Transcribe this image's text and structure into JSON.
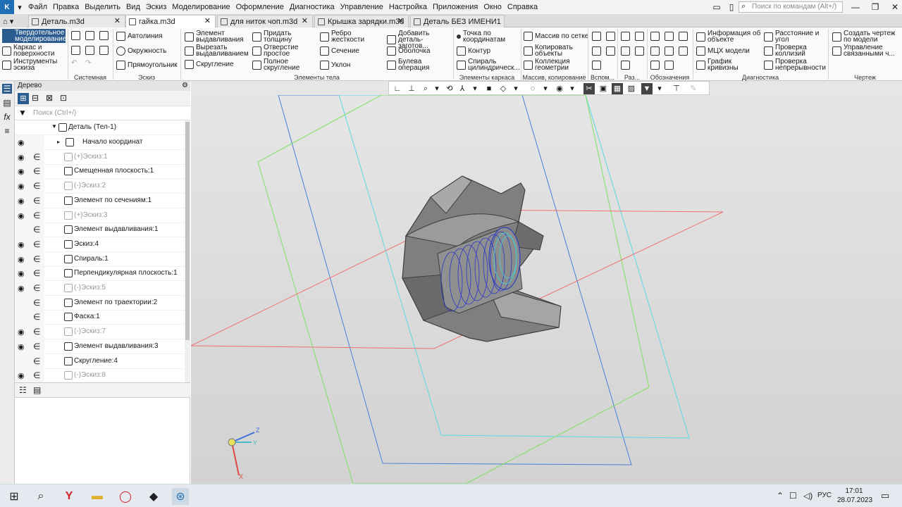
{
  "menu": [
    "Файл",
    "Правка",
    "Выделить",
    "Вид",
    "Эскиз",
    "Моделирование",
    "Оформление",
    "Диагностика",
    "Управление",
    "Настройка",
    "Приложения",
    "Окно",
    "Справка"
  ],
  "search": {
    "placeholder": "Поиск по командам (Alt+/)"
  },
  "tabs": [
    "Деталь.m3d",
    "гайка.m3d",
    "для ниток чоп.m3d",
    "Крышка зарядки.m3d",
    "Деталь БЕЗ ИМЕНИ1"
  ],
  "ribbon": {
    "mode_label": "Твердотельное моделирование",
    "mode_items": [
      "Каркас и поверхности",
      "Инструменты эскиза"
    ],
    "sketch": [
      "Автолиния",
      "Окружность",
      "Прямоугольник"
    ],
    "body": [
      "Элемент выдавливания",
      "Вырезать выдавливанием",
      "Скругление",
      "Придать толщину",
      "Отверстие простое",
      "Полное скругление",
      "Ребро жесткости",
      "Сечение",
      "Уклон",
      "Добавить деталь-заготов...",
      "Оболочка",
      "Булева операция"
    ],
    "frame": [
      "Точка по координатам",
      "Контур",
      "Спираль цилиндрическ..."
    ],
    "arrays": [
      "Массив по сетке",
      "Копировать объекты",
      "Коллекция геометрии"
    ],
    "diag": [
      "Информация об объекте",
      "МЦХ модели",
      "График кривизны",
      "Расстояние и угол",
      "Проверка коллизий",
      "Проверка непрерывности"
    ],
    "drawing": [
      "Создать чертеж по модели",
      "Управление связанными ч..."
    ],
    "groups": [
      "Системная",
      "Эскиз",
      "Элементы тела",
      "Элементы каркаса",
      "Массив, копирование",
      "Вспом...",
      "Раз...",
      "Обозначения",
      "Диагностика",
      "Чертеж"
    ]
  },
  "tree": {
    "title": "Дерево",
    "search_placeholder": "Поиск (Ctrl+/)",
    "root": "Деталь (Тел-1)",
    "items": [
      {
        "label": "Начало координат",
        "dim": false,
        "eye": false
      },
      {
        "label": "(+)Эскиз:1",
        "dim": true,
        "eye": true
      },
      {
        "label": "Смещенная плоскость:1",
        "dim": false,
        "eye": true
      },
      {
        "label": "(-)Эскиз:2",
        "dim": true,
        "eye": true
      },
      {
        "label": "Элемент по сечениям:1",
        "dim": false,
        "eye": true
      },
      {
        "label": "(+)Эскиз:3",
        "dim": true,
        "eye": true
      },
      {
        "label": "Элемент выдавливания:1",
        "dim": false,
        "eye": false
      },
      {
        "label": "Эскиз:4",
        "dim": false,
        "eye": true
      },
      {
        "label": "Спираль:1",
        "dim": false,
        "eye": true
      },
      {
        "label": "Перпендикулярная плоскость:1",
        "dim": false,
        "eye": true
      },
      {
        "label": "(-)Эскиз:5",
        "dim": true,
        "eye": true
      },
      {
        "label": "Элемент по траектории:2",
        "dim": false,
        "eye": false
      },
      {
        "label": "Фаска:1",
        "dim": false,
        "eye": false
      },
      {
        "label": "(-)Эскиз:7",
        "dim": true,
        "eye": true
      },
      {
        "label": "Элемент выдавливания:3",
        "dim": false,
        "eye": true
      },
      {
        "label": "Скругление:4",
        "dim": false,
        "eye": false
      },
      {
        "label": "(-)Эскиз:8",
        "dim": true,
        "eye": true
      }
    ]
  },
  "axes": {
    "z": "Z",
    "y": "Y",
    "x": "X"
  },
  "taskbar": {
    "lang": "РУС",
    "time": "17:01",
    "date": "28.07.2023"
  }
}
